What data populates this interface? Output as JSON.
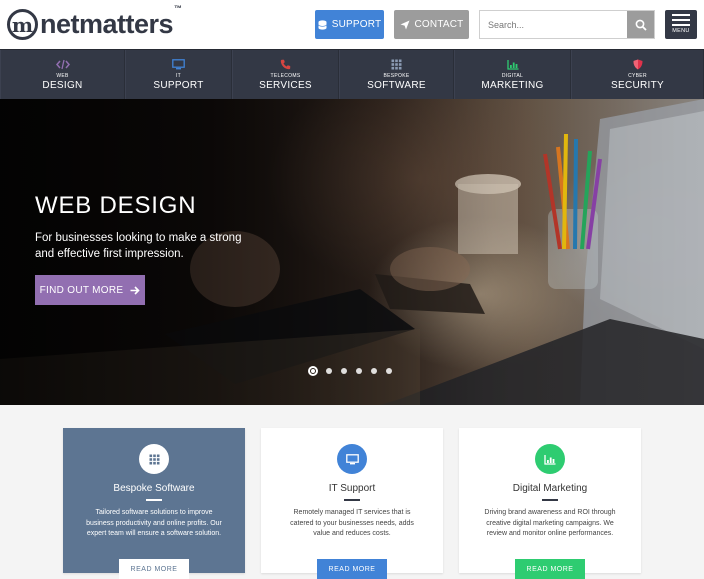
{
  "header": {
    "logo_mark": "m",
    "logo_text": "netmatters",
    "logo_tm": "™",
    "support_label": "SUPPORT",
    "contact_label": "CONTACT",
    "search_placeholder": "Search...",
    "menu_label": "MENU"
  },
  "nav": [
    {
      "small": "WEB",
      "big": "DESIGN",
      "icon": "code-icon",
      "color": "#926fb1"
    },
    {
      "small": "IT",
      "big": "SUPPORT",
      "icon": "monitor-icon",
      "color": "#4183d7"
    },
    {
      "small": "TELECOMS",
      "big": "SERVICES",
      "icon": "phone-icon",
      "color": "#d64541"
    },
    {
      "small": "BESPOKE",
      "big": "SOFTWARE",
      "icon": "grid-icon",
      "color": "#5d7592"
    },
    {
      "small": "DIGITAL",
      "big": "MARKETING",
      "icon": "chart-icon",
      "color": "#2ecc71"
    },
    {
      "small": "CYBER",
      "big": "SECURITY",
      "icon": "shield-icon",
      "color": "#e0324b"
    }
  ],
  "hero": {
    "title": "WEB DESIGN",
    "text": "For businesses looking to make a strong and effective first impression.",
    "button": "FIND OUT MORE",
    "slides_total": 6,
    "active_slide": 1
  },
  "cards": [
    {
      "title": "Bespoke Software",
      "text": "Tailored software solutions to improve business productivity and online profits. Our expert team will ensure a software solution.",
      "button": "READ MORE",
      "icon": "grid-icon",
      "accent": "#5d7592"
    },
    {
      "title": "IT Support",
      "text": "Remotely managed IT services that is catered to your businesses needs, adds value and reduces costs.",
      "button": "READ MORE",
      "icon": "monitor-icon",
      "accent": "#4183d7"
    },
    {
      "title": "Digital Marketing",
      "text": "Driving brand awareness and ROI through creative digital marketing campaigns. We review and monitor online performances.",
      "button": "READ MORE",
      "icon": "chart-icon",
      "accent": "#2ecc71"
    }
  ],
  "colors": {
    "dark": "#333845",
    "support_blue": "#4183d7",
    "contact_grey": "#9c9c9c",
    "hero_button": "#926fb1"
  }
}
